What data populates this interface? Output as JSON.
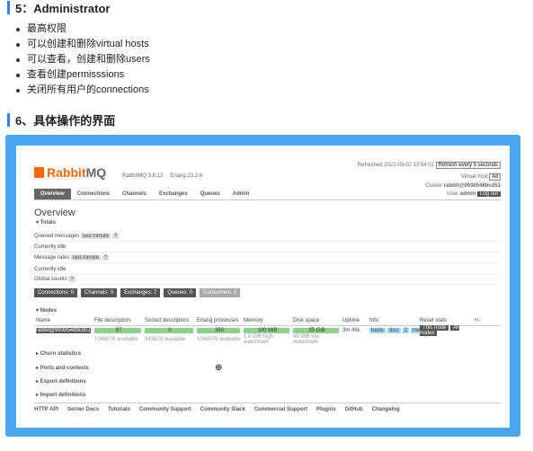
{
  "section5": {
    "title": "5：Administrator",
    "items": [
      "最高权限",
      "可以创建和删除virtual hosts",
      "可以查看，创建和删除users",
      "查看创建permisssions",
      "关闭所有用户的connections"
    ]
  },
  "section6": {
    "title": "6、具体操作的界面"
  },
  "rmq": {
    "logo_rabbit": "Rabbit",
    "logo_mq": "MQ",
    "version": "RabbitMQ 3.8.13",
    "erlang": "Erlang 23.2.6",
    "refreshed": "Refreshed 2021-03-02 13:54:02",
    "refresh_select": "Refresh every 5 seconds",
    "vhost_label": "Virtual host",
    "vhost_value": "All",
    "cluster_label": "Cluster",
    "cluster_value": "rabbit@9938548bcd51",
    "user_label": "User",
    "user_value": "admin",
    "logout": "Log out",
    "tabs": [
      "Overview",
      "Connections",
      "Channels",
      "Exchanges",
      "Queues",
      "Admin"
    ],
    "page_title": "Overview",
    "totals": "Totals",
    "queued_messages": "Queued messages",
    "last_minute": "last minute",
    "help": "?",
    "currently_idle": "Currently idle",
    "message_rates": "Message rates",
    "global_counts": "Global counts",
    "counts": [
      "Connections: 0",
      "Channels: 0",
      "Exchanges: 7",
      "Queues: 0",
      "Consumers: 0"
    ],
    "nodes": "Nodes",
    "node_headers": [
      "Name",
      "File descriptors",
      "Socket descriptors",
      "Erlang processes",
      "Memory",
      "Disk space",
      "Uptime",
      "Info",
      "Reset stats"
    ],
    "node_values": [
      "rabbit@9938548bcd51",
      "97",
      "0",
      "350",
      "100 MiB",
      "35 GiB",
      "3m 49s"
    ],
    "node_subs": [
      "1048576 available",
      "943629 available",
      "1048576 available",
      "1.6 GiB high watermark",
      "48 MiB low watermark"
    ],
    "info_pills": [
      "basic",
      "disc",
      "2",
      "rss"
    ],
    "reset_buttons": [
      "This node",
      "All nodes"
    ],
    "plus_minus": "+/-",
    "collapsed": [
      "Churn statistics",
      "Ports and contexts",
      "Export definitions",
      "Import definitions"
    ],
    "footer": [
      "HTTP API",
      "Server Docs",
      "Tutorials",
      "Community Support",
      "Community Slack",
      "Commercial Support",
      "Plugins",
      "GitHub",
      "Changelog"
    ]
  }
}
